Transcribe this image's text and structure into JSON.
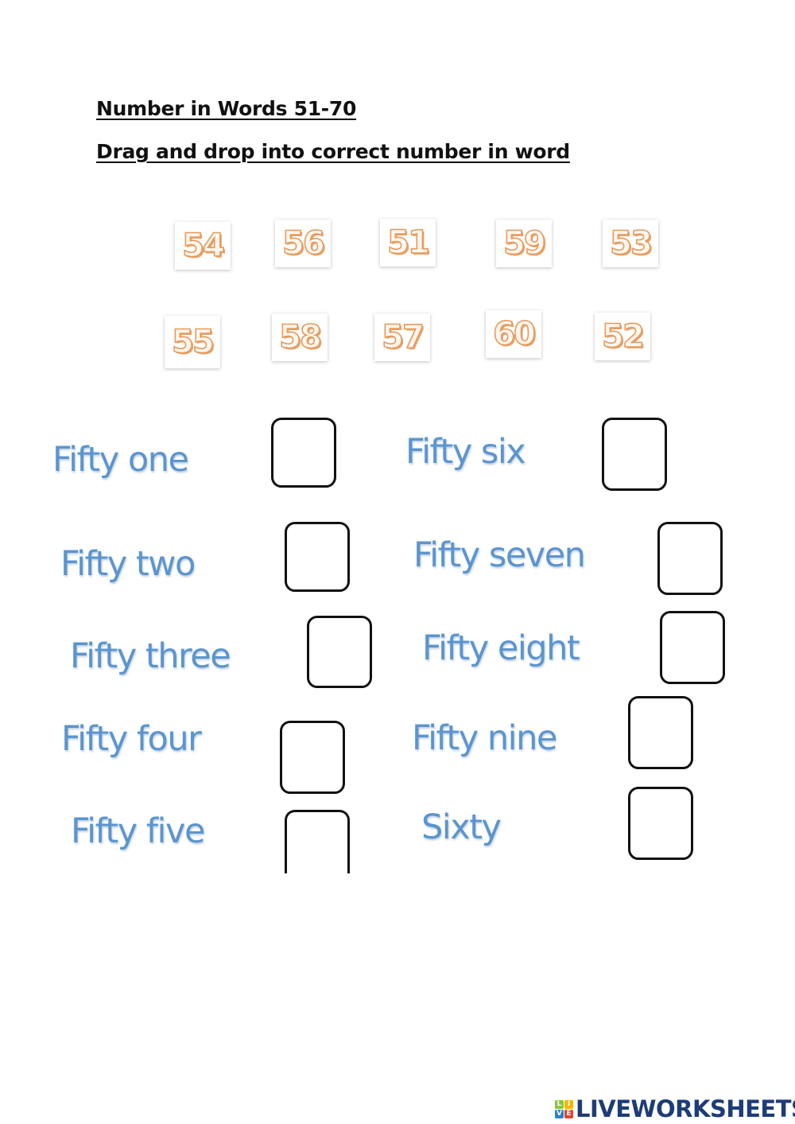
{
  "header": {
    "title": "Number in Words 51-70",
    "instruction": "Drag and drop into correct number in word"
  },
  "number_tiles": {
    "row1": [
      "54",
      "56",
      "51",
      "59",
      "53"
    ],
    "row2": [
      "55",
      "58",
      "57",
      "60",
      "52"
    ],
    "colors": {
      "fill": "#fdf6ef",
      "outline": "#e59a5c"
    }
  },
  "words": {
    "left": [
      "Fifty one",
      "Fifty two",
      "Fifty three",
      "Fifty four",
      "Fifty five"
    ],
    "right": [
      "Fifty six",
      "Fifty seven",
      "Fifty eight",
      "Fifty nine",
      "Sixty"
    ],
    "color": "#5b95cf"
  },
  "footer": {
    "logo_letters": [
      "L",
      "I",
      "V",
      "E"
    ],
    "logo_colors": [
      "#8cc63f",
      "#f7b500",
      "#2f80c8",
      "#e8412c"
    ],
    "logo_text": "LIVEWORKSHEETS"
  }
}
